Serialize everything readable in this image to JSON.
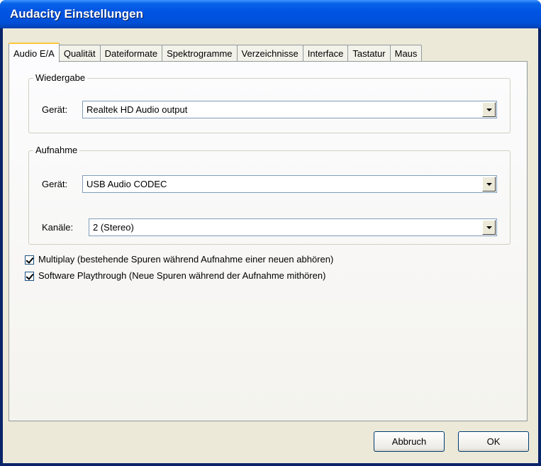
{
  "window": {
    "title": "Audacity Einstellungen"
  },
  "tabs": [
    {
      "label": "Audio E/A",
      "active": true
    },
    {
      "label": "Qualität",
      "active": false
    },
    {
      "label": "Dateiformate",
      "active": false
    },
    {
      "label": "Spektrogramme",
      "active": false
    },
    {
      "label": "Verzeichnisse",
      "active": false
    },
    {
      "label": "Interface",
      "active": false
    },
    {
      "label": "Tastatur",
      "active": false
    },
    {
      "label": "Maus",
      "active": false
    }
  ],
  "playback": {
    "group_label": "Wiedergabe",
    "device_label": "Gerät:",
    "device_value": "Realtek HD Audio output"
  },
  "recording": {
    "group_label": "Aufnahme",
    "device_label": "Gerät:",
    "device_value": "USB Audio CODEC",
    "channels_label": "Kanäle:",
    "channels_value": "2 (Stereo)"
  },
  "options": [
    {
      "label": "Multiplay (bestehende Spuren während Aufnahme einer neuen abhören)",
      "checked": true
    },
    {
      "label": "Software Playthrough (Neue Spuren während der Aufnahme mithören)",
      "checked": true
    }
  ],
  "buttons": {
    "cancel": "Abbruch",
    "ok": "OK"
  },
  "colors": {
    "title_bar": "#0054e3",
    "dialog_bg": "#ece9d8",
    "active_tab_highlight": "#ffc83c"
  }
}
